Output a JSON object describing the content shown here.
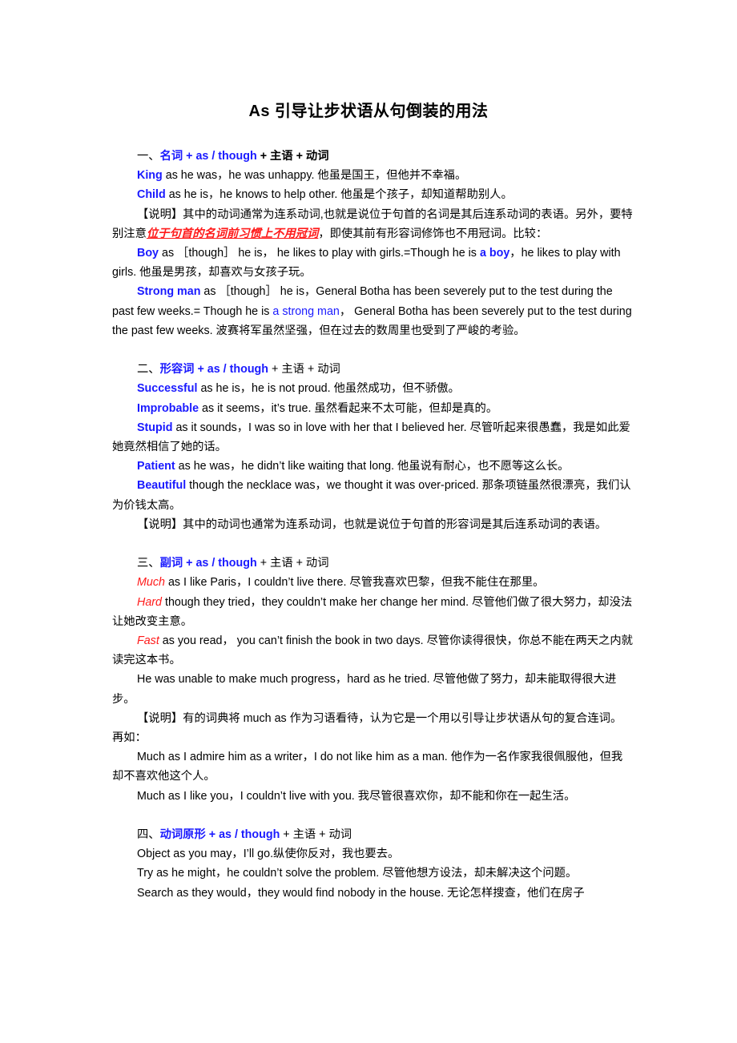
{
  "title": "As 引导让步状语从句倒装的用法",
  "sections": [
    {
      "number": "一、",
      "category": "名词",
      "connector": " + as / though",
      "formula_rest": " +  主语  +  动词",
      "bold_rest": true,
      "examples": [
        {
          "lead": "King",
          "text": " as he was，he was unhappy.  他虽是国王，但他并不幸福。"
        },
        {
          "lead": "Child",
          "text": " as he is，he knows to help other.  他虽是个孩子，却知道帮助别人。"
        }
      ],
      "note": {
        "pre": "【说明】其中的动词通常为连系动词,也就是说位于句首的名词是其后连系动词的表语。另外，要特别注意",
        "highlight": "位于句首的名词前习惯上不用冠词",
        "post": "，即使其前有形容词修饰也不用冠词。比较："
      },
      "comparisons": [
        {
          "lead": "Boy",
          "mid": " as  ［though］  he is，  he likes to play with girls.=Though he is ",
          "mid_blue": "a boy",
          "end": "，he likes to play with girls.  他虽是男孩，却喜欢与女孩子玩。"
        },
        {
          "lead": "Strong man",
          "mid": " as  ［though］  he is，General Botha has been severely put to the test during the past few weeks.= Though he is ",
          "mid_blue": "a strong man",
          "end": "，   General Botha has been severely put to the test during the past few weeks.  波赛将军虽然坚强，但在过去的数周里也受到了严峻的考验。"
        }
      ]
    },
    {
      "number": "二、",
      "category": "形容词",
      "connector": " + as / though",
      "formula_rest": " +  主语  +  动词",
      "examples": [
        {
          "lead": "Successful",
          "text": " as he is，he is not proud.  他虽然成功，但不骄傲。"
        },
        {
          "lead": "Improbable",
          "text": " as it seems，it’s true.  虽然看起来不太可能，但却是真的。"
        },
        {
          "lead": "Stupid",
          "text": " as it sounds，I was so in love with her that I believed her.  尽管听起来很愚蠢，我是如此爱她竟然相信了她的话。"
        },
        {
          "lead": "Patient",
          "text": " as he was，he didn’t like waiting that long.  他虽说有耐心，也不愿等这么长。"
        },
        {
          "lead": "Beautiful",
          "text": " though the necklace was，we thought it was over-priced.  那条项链虽然很漂亮，我们认为价钱太高。"
        }
      ],
      "note": "【说明】其中的动词也通常为连系动词，也就是说位于句首的形容词是其后连系动词的表语。"
    },
    {
      "number": "三、",
      "category": "副词",
      "connector": " + as / though",
      "formula_rest": " +  主语  +  动词",
      "examples": [
        {
          "lead": "Much",
          "text": " as I like Paris，I couldn’t live there.  尽管我喜欢巴黎，但我不能住在那里。"
        },
        {
          "lead": "Hard",
          "text": " though they tried，they couldn’t make her change her mind.  尽管他们做了很大努力，却没法让她改变主意。"
        },
        {
          "lead": "Fast",
          "text": " as you read，   you can’t finish the book in two days.  尽管你读得很快，你总不能在两天之内就读完这本书。"
        }
      ],
      "plain_example": "He was unable to make much progress，hard as he tried.  尽管他做了努力，却未能取得很大进步。",
      "note": "【说明】有的词典将  much as  作为习语看待，认为它是一个用以引导让步状语从句的复合连词。再如：",
      "more_examples": [
        "Much as I admire him as a writer，I do not like him as a man.  他作为一名作家我很佩服他，但我却不喜欢他这个人。",
        "Much as I like you，I couldn’t live with you.  我尽管很喜欢你，却不能和你在一起生活。"
      ]
    },
    {
      "number": "四、",
      "category": "动词原形",
      "connector": " + as / though",
      "formula_rest": " +  主语  +  动词",
      "examples": [
        "Object as you may，I’ll go.纵使你反对，我也要去。",
        "Try as he might，he couldn’t solve the problem.  尽管他想方设法，却未解决这个问题。",
        "Search as they would，they would find nobody in the house.  无论怎样搜查，他们在房子"
      ]
    }
  ],
  "colors": {
    "blue": "#1a1aff",
    "red": "#ff1a1a"
  }
}
